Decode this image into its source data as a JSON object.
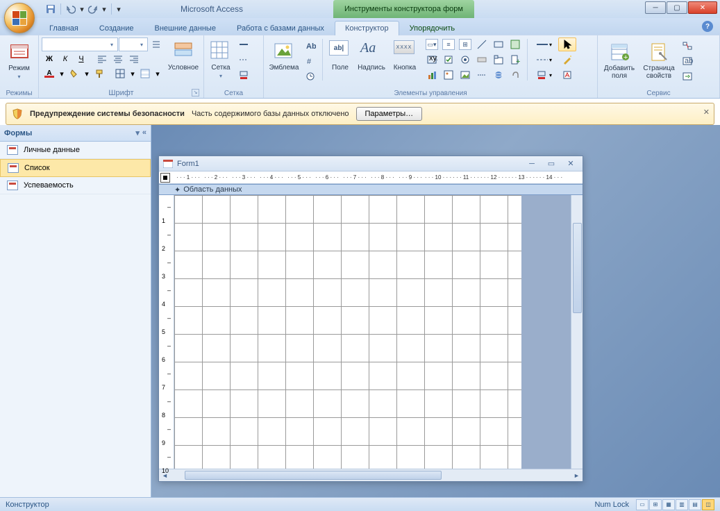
{
  "app": {
    "title": "Microsoft Access",
    "context_title": "Инструменты конструктора форм"
  },
  "qat": {
    "save": "💾",
    "undo": "↶",
    "redo": "↷"
  },
  "tabs": {
    "home": "Главная",
    "create": "Создание",
    "external": "Внешние данные",
    "dbtools": "Работа с базами данных",
    "designer": "Конструктор",
    "arrange": "Упорядочить"
  },
  "ribbon": {
    "groups": {
      "modes": {
        "label": "Режимы",
        "view_btn": "Режим"
      },
      "font": {
        "label": "Шрифт",
        "bold": "Ж",
        "italic": "К",
        "underline": "Ч",
        "conditional": "Условное"
      },
      "grid": {
        "label": "Сетка",
        "grid_btn": "Сетка"
      },
      "controls": {
        "label": "Элементы управления",
        "emblem": "Эмблема",
        "field": "Поле",
        "label_ctl": "Надпись",
        "button": "Кнопка"
      },
      "service": {
        "label": "Сервис",
        "add_fields": "Добавить поля",
        "prop_sheet": "Страница свойств"
      }
    }
  },
  "security": {
    "heading": "Предупреждение системы безопасности",
    "message": "Часть содержимого базы данных отключено",
    "button": "Параметры…"
  },
  "nav": {
    "header": "Формы",
    "items": [
      "Личные данные",
      "Список",
      "Успеваемость"
    ],
    "selected_index": 1
  },
  "form_window": {
    "title": "Form1",
    "section": "Область данных",
    "ruler_h": [
      1,
      2,
      3,
      4,
      5,
      6,
      7,
      8,
      9,
      10,
      11,
      12,
      13,
      14
    ],
    "ruler_v": [
      1,
      2,
      3,
      4,
      5,
      6,
      7,
      8,
      9,
      10
    ]
  },
  "status": {
    "mode": "Конструктор",
    "numlock": "Num Lock"
  }
}
